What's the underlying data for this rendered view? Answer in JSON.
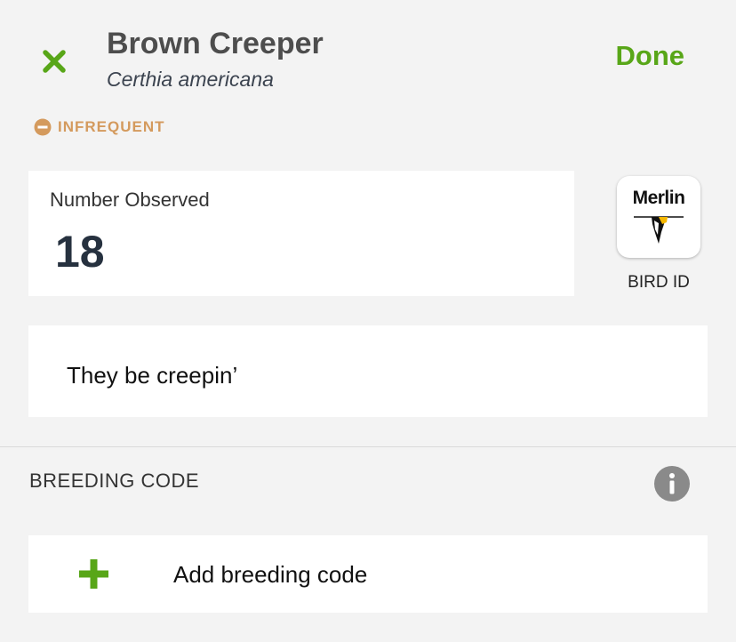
{
  "header": {
    "close_icon": "close-x-icon",
    "species_common": "Brown Creeper",
    "species_scientific": "Certhia americana",
    "done_label": "Done",
    "accent_color": "#58a618"
  },
  "frequency": {
    "icon": "minus-circle-icon",
    "label": "INFREQUENT",
    "color": "#d49a5d"
  },
  "count": {
    "label": "Number Observed",
    "value": "18"
  },
  "merlin": {
    "brand": "Merlin",
    "caption": "BIRD ID"
  },
  "comments": {
    "value": "They be creepin’"
  },
  "breeding": {
    "header": "BREEDING CODE",
    "info_icon": "info-icon",
    "add_icon": "plus-icon",
    "add_label": "Add breeding code"
  }
}
